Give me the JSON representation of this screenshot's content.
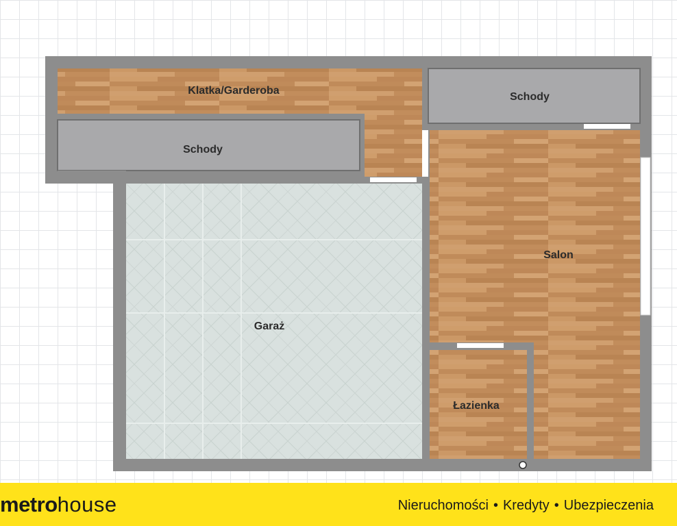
{
  "floor_plan": {
    "rooms": {
      "klatka_garderoba": "Klatka/Garderoba",
      "schody_left": "Schody",
      "schody_right": "Schody",
      "salon": "Salon",
      "garaz": "Garaż",
      "lazienka": "Łazienka"
    }
  },
  "footer": {
    "logo_metro": "metro",
    "logo_house": "house",
    "services": [
      "Nieruchomości",
      "Kredyty",
      "Ubezpieczenia"
    ],
    "separator": "•"
  },
  "colors": {
    "wall": "#8b8b8b",
    "wood": "#c48f5d",
    "stairs": "#a8a8aa",
    "garage_tile": "#d7e0de",
    "footer_background": "#ffe21a"
  }
}
